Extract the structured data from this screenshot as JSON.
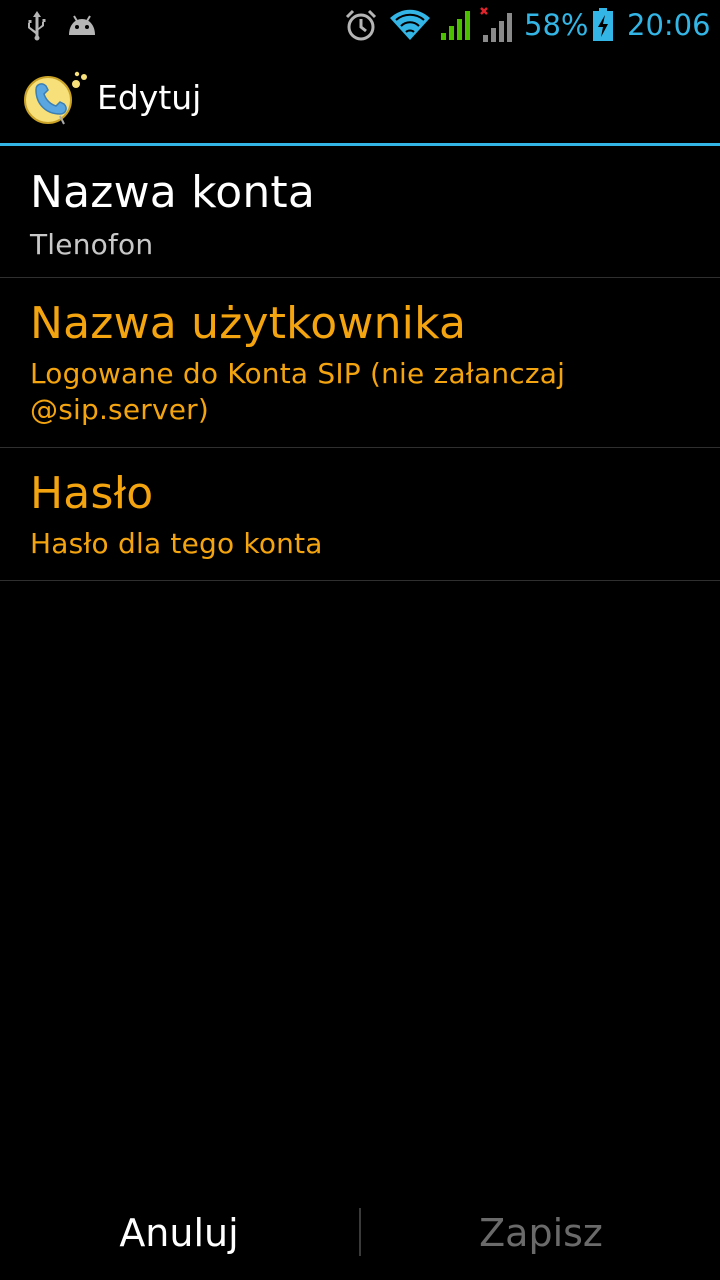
{
  "status_bar": {
    "battery_percent": "58%",
    "time": "20:06",
    "accent_color": "#33b5e5",
    "icons": [
      "usb-icon",
      "android-debug-icon",
      "alarm-icon",
      "wifi-icon",
      "signal-icon",
      "signal-no-data-icon",
      "battery-charging-icon"
    ]
  },
  "action_bar": {
    "title": "Edytuj",
    "app_icon": "app-logo-icon"
  },
  "preferences": {
    "account_name": {
      "title": "Nazwa konta",
      "summary": "Tlenofon"
    },
    "username": {
      "title": "Nazwa użytkownika",
      "summary": "Logowane do Konta SIP (nie załanczaj @sip.server)"
    },
    "password": {
      "title": "Hasło",
      "summary": "Hasło dla tego konta"
    }
  },
  "buttons": {
    "cancel": "Anuluj",
    "save": "Zapisz"
  },
  "colors": {
    "background": "#000000",
    "highlight": "#f3a40f",
    "divider": "#33b5e5",
    "disabled_text": "#6a6a6a"
  }
}
